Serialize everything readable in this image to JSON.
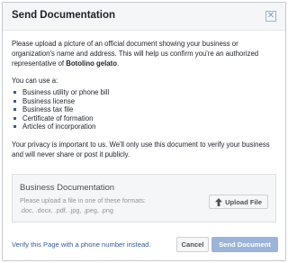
{
  "dialog": {
    "title": "Send Documentation",
    "close_icon": "close-icon"
  },
  "body": {
    "intro_text": "Please upload a picture of an official document showing your business or organization's name and address. This will help us confirm you're an authorized representative of ",
    "business_name": "Botolino gelato",
    "intro_end": ".",
    "use_label": "You can use a:",
    "document_types": [
      "Business utility or phone bill",
      "Business license",
      "Business tax file",
      "Certificate of formation",
      "Articles of incorporation"
    ],
    "privacy_text": "Your privacy is important to us. We'll only use this document to verify your business and will never share or post it publicly."
  },
  "upload": {
    "title": "Business Documentation",
    "hint_line1": "Please upload a file in one of these formats:",
    "hint_line2": ".doc, .docx, .pdf, .jpg, .jpeg, .png",
    "button_label": "Upload File",
    "button_icon": "upload-arrow-icon"
  },
  "footer": {
    "verify_link": "Verify this Page with a phone number instead.",
    "cancel_label": "Cancel",
    "send_label": "Send Document"
  },
  "colors": {
    "link": "#365899",
    "send_disabled_bg": "#9cb4d8",
    "header_bg": "#f5f6f7"
  }
}
